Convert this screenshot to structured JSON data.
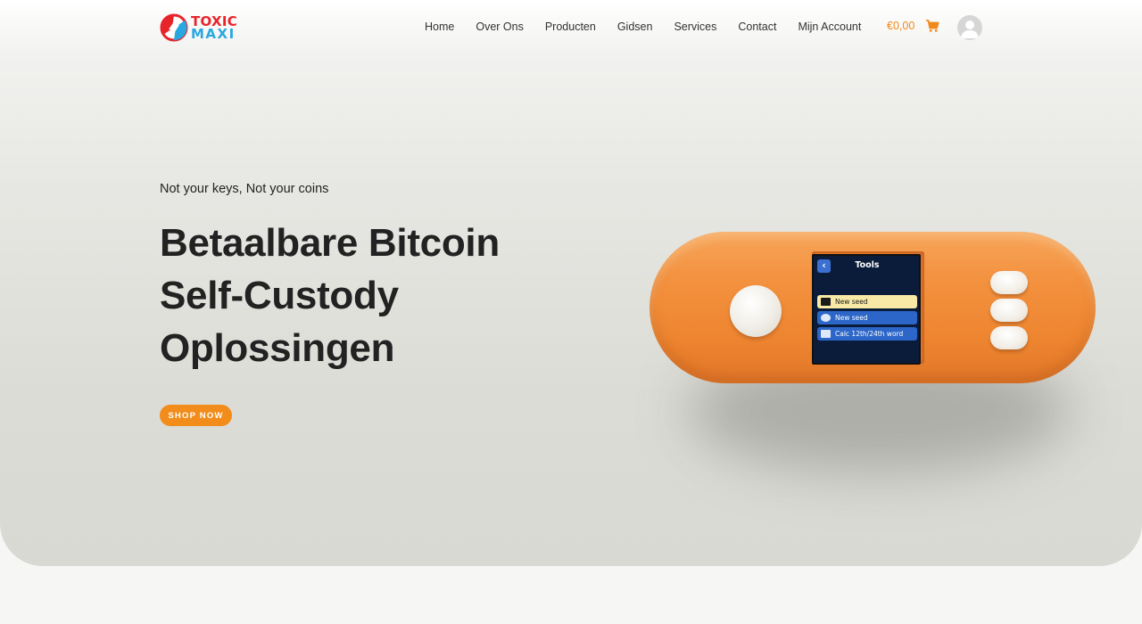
{
  "header": {
    "logo": {
      "line1": "TOXIC",
      "line2": "MAXI"
    },
    "nav": [
      {
        "label": "Home"
      },
      {
        "label": "Over Ons"
      },
      {
        "label": "Producten"
      },
      {
        "label": "Gidsen"
      },
      {
        "label": "Services"
      },
      {
        "label": "Contact"
      },
      {
        "label": "Mijn Account"
      }
    ],
    "cart_total": "€0,00",
    "cart_icon": "cart-icon",
    "avatar_icon": "user-avatar-icon"
  },
  "hero": {
    "tagline": "Not your keys, Not your coins",
    "headline_lines": [
      "Betaalbare Bitcoin",
      "Self-Custody",
      "Oplossingen"
    ],
    "cta_label": "SHOP NOW",
    "accent_color": "#f28c1a"
  },
  "device": {
    "screen_title": "Tools",
    "back_label": "‹",
    "menu": [
      {
        "label": "New seed",
        "icon": "camera-icon"
      },
      {
        "label": "New seed",
        "icon": "dice-icon"
      },
      {
        "label": "Calc 12th/24th word",
        "icon": "keyboard-icon"
      }
    ]
  }
}
